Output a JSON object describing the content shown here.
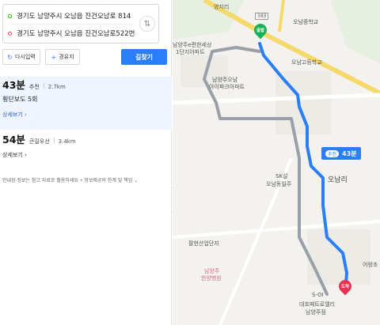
{
  "search": {
    "origin": "경기도 남양주시 오남읍 진건오남로 814",
    "destination": "경기도 남양주시 오남읍 진건오남로522번",
    "swap_icon": "swap-arrows-icon"
  },
  "buttons": {
    "reset": "다시입력",
    "via": "경유지",
    "go": "길찾기"
  },
  "routes": [
    {
      "time": "43분",
      "tag": "추천",
      "distance": "2.7km",
      "detail": "횡단보도 5회",
      "more": "상세보기"
    },
    {
      "time": "54분",
      "tag": "큰길우선",
      "distance": "3.4km",
      "more": "상세보기"
    }
  ],
  "notice": "안내된 정보는 참고 자료로 활용하세요 • 정보제공의 한계 및 책임",
  "map": {
    "labels": {
      "yangji": "양지리",
      "road383": "383",
      "onam_middle": "오남중학교",
      "onam_high": "오남고등학교",
      "apt1": "남양주e편한세상",
      "apt1b": "1단지아파트",
      "apt2": "남양주오남",
      "apt2b": "아이파크아파트",
      "sk1": "SK설",
      "sk2": "오남동일주",
      "onamri": "오남리",
      "industrial": "팔현산업단지",
      "hospital1": "남양주",
      "hospital2": "한양병원",
      "s_oil": "S-OI",
      "daeho": "대호페트로엘리",
      "namyang": "남양주점",
      "eorang": "어랑초"
    },
    "route_badge": {
      "tag": "추천",
      "time": "43분"
    },
    "start_pin": "출발",
    "end_pin": "도착",
    "route_color": "#2a7ef7",
    "alt_route_color": "#9aa0a8"
  }
}
